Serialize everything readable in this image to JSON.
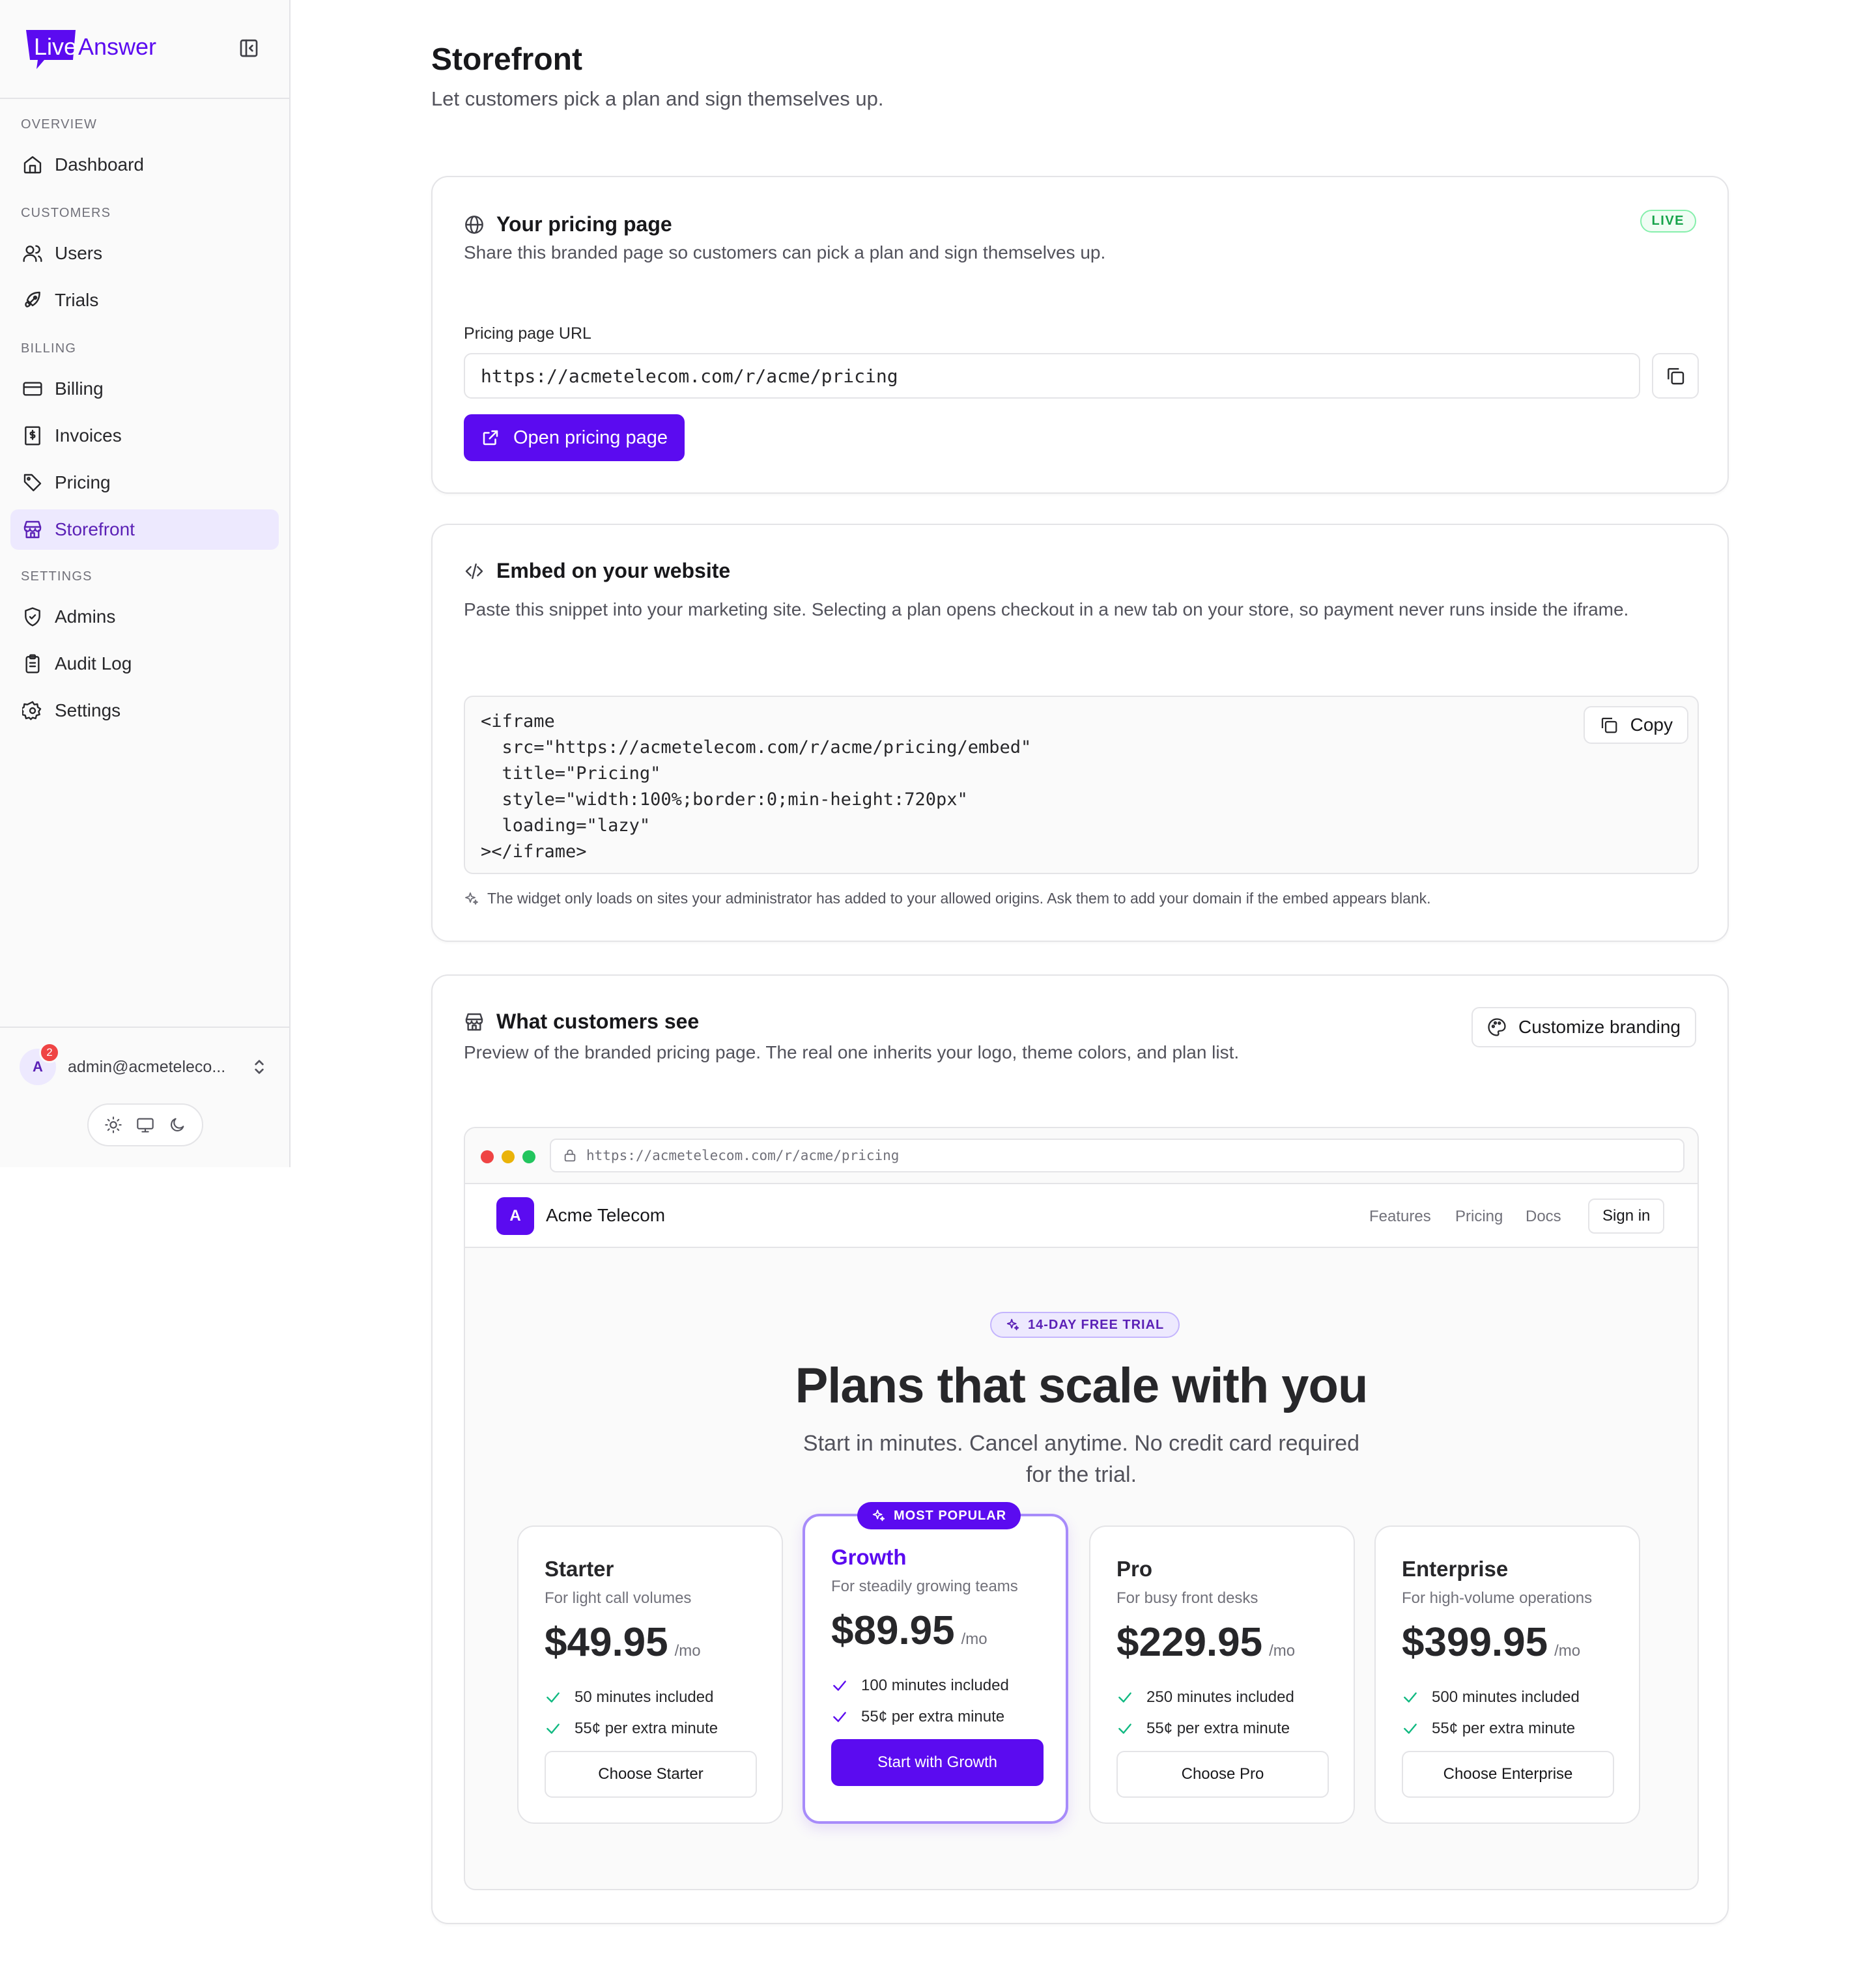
{
  "sidebar": {
    "brand": {
      "part1": "Live",
      "part2": "Answer",
      "accent_color": "#5b0bf0"
    },
    "sections": [
      {
        "label": "OVERVIEW",
        "items": [
          {
            "label": "Dashboard",
            "icon": "home-icon"
          }
        ]
      },
      {
        "label": "CUSTOMERS",
        "items": [
          {
            "label": "Users",
            "icon": "users-icon"
          },
          {
            "label": "Trials",
            "icon": "rocket-icon"
          }
        ]
      },
      {
        "label": "BILLING",
        "items": [
          {
            "label": "Billing",
            "icon": "credit-card-icon"
          },
          {
            "label": "Invoices",
            "icon": "receipt-icon"
          },
          {
            "label": "Pricing",
            "icon": "tag-icon"
          },
          {
            "label": "Storefront",
            "icon": "store-icon",
            "active": true
          }
        ]
      },
      {
        "label": "SETTINGS",
        "items": [
          {
            "label": "Admins",
            "icon": "shield-icon"
          },
          {
            "label": "Audit Log",
            "icon": "clipboard-icon"
          },
          {
            "label": "Settings",
            "icon": "gear-icon"
          }
        ]
      }
    ],
    "account": {
      "avatar_initial": "A",
      "notification_count": "2",
      "email": "admin@acmeteleco..."
    }
  },
  "page": {
    "title": "Storefront",
    "subtitle": "Let customers pick a plan and sign themselves up."
  },
  "pricing_card": {
    "title": "Your pricing page",
    "description": "Share this branded page so customers can pick a plan and sign themselves up.",
    "status_badge": "LIVE",
    "url_label": "Pricing page URL",
    "url_value": "https://acmetelecom.com/r/acme/pricing",
    "open_button": "Open pricing page"
  },
  "embed_card": {
    "title": "Embed on your website",
    "description": "Paste this snippet into your marketing site. Selecting a plan opens checkout in a new tab on your store, so payment never runs inside the iframe.",
    "code_lines": [
      "<iframe",
      "  src=\"https://acmetelecom.com/r/acme/pricing/embed\"",
      "  title=\"Pricing\"",
      "  style=\"width:100%;border:0;min-height:720px\"",
      "  loading=\"lazy\"",
      "></iframe>"
    ],
    "copy_button": "Copy",
    "hint": "The widget only loads on sites your administrator has added to your allowed origins. Ask them to add your domain if the embed appears blank."
  },
  "preview_card": {
    "title": "What customers see",
    "description": "Preview of the branded pricing page. The real one inherits your logo, theme colors, and plan list.",
    "branding_button": "Customize branding",
    "browser_url": "https://acmetelecom.com/r/acme/pricing",
    "site": {
      "logo_initial": "A",
      "name": "Acme Telecom",
      "nav": [
        "Features",
        "Pricing",
        "Docs"
      ],
      "signin": "Sign in"
    },
    "trial_badge": "14-DAY FREE TRIAL",
    "hero_title": "Plans that scale with you",
    "hero_sub_line1": "Start in minutes. Cancel anytime. No credit card required",
    "hero_sub_line2": "for the trial.",
    "popular_badge": "MOST POPULAR",
    "plans": [
      {
        "name": "Starter",
        "tagline": "For light call volumes",
        "price": "$49.95",
        "period": "/mo",
        "features": [
          "50 minutes included",
          "55¢ per extra minute"
        ],
        "cta": "Choose Starter"
      },
      {
        "name": "Growth",
        "tagline": "For steadily growing teams",
        "price": "$89.95",
        "period": "/mo",
        "features": [
          "100 minutes included",
          "55¢ per extra minute"
        ],
        "cta": "Start with Growth",
        "featured": true
      },
      {
        "name": "Pro",
        "tagline": "For busy front desks",
        "price": "$229.95",
        "period": "/mo",
        "features": [
          "250 minutes included",
          "55¢ per extra minute"
        ],
        "cta": "Choose Pro"
      },
      {
        "name": "Enterprise",
        "tagline": "For high-volume operations",
        "price": "$399.95",
        "period": "/mo",
        "features": [
          "500 minutes included",
          "55¢ per extra minute"
        ],
        "cta": "Choose Enterprise"
      }
    ]
  }
}
